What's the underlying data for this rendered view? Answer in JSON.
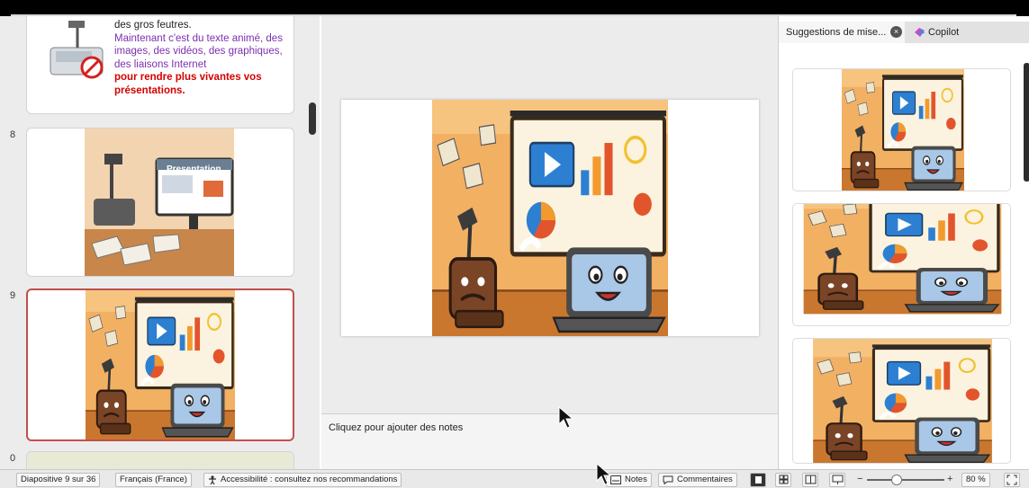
{
  "thumbnails": {
    "slide8_number": "8",
    "slide9_number": "9",
    "slide10_number": "0",
    "slide7_text": {
      "line1": "des gros feutres.",
      "purple": "Maintenant c'est du texte animé, des images, des vidéos, des graphiques, des liaisons Internet",
      "red": "pour rendre plus vivantes vos présentations."
    },
    "slide8_title": "Presentation"
  },
  "notes": {
    "placeholder": "Cliquez pour ajouter des notes"
  },
  "pane": {
    "tab_suggestions": "Suggestions de mise...",
    "tab_close": "×",
    "tab_copilot": "Copilot"
  },
  "status_bar": {
    "slide_counter": "Diapositive 9 sur 36",
    "language": "Français (France)",
    "accessibility": "Accessibilité : consultez nos recommandations",
    "notes": "Notes",
    "comments": "Commentaires",
    "zoom": "80 %",
    "zoom_minus": "−",
    "zoom_plus": "+"
  },
  "colors": {
    "selected_border": "#c0504d",
    "illustration_bg": "#f2b063",
    "accent_blue": "#2d7fd1"
  },
  "icons": [
    "accessibility-icon",
    "notes-icon",
    "comments-icon",
    "normal-view-icon",
    "slide-sorter-icon",
    "reading-view-icon",
    "slideshow-icon",
    "fit-to-window-icon",
    "close-icon",
    "copilot-icon"
  ]
}
